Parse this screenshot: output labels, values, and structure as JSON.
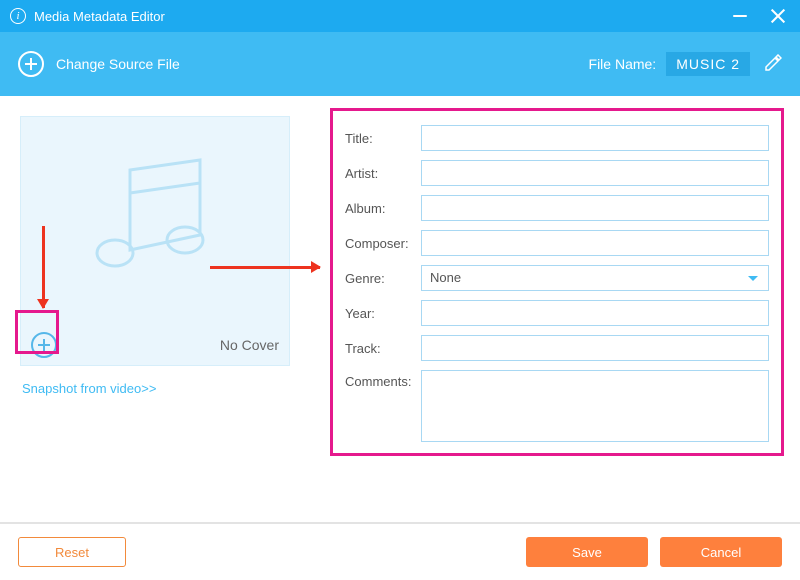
{
  "titlebar": {
    "title": "Media Metadata Editor"
  },
  "toolbar": {
    "change_source_label": "Change Source File",
    "file_name_label": "File Name:",
    "file_name_value": "MUSIC 2"
  },
  "cover": {
    "no_cover_label": "No Cover",
    "snapshot_link": "Snapshot from video>>"
  },
  "form": {
    "title": {
      "label": "Title:",
      "value": ""
    },
    "artist": {
      "label": "Artist:",
      "value": ""
    },
    "album": {
      "label": "Album:",
      "value": ""
    },
    "composer": {
      "label": "Composer:",
      "value": ""
    },
    "genre": {
      "label": "Genre:",
      "value": "None"
    },
    "year": {
      "label": "Year:",
      "value": ""
    },
    "track": {
      "label": "Track:",
      "value": ""
    },
    "comments": {
      "label": "Comments:",
      "value": ""
    }
  },
  "footer": {
    "reset_label": "Reset",
    "save_label": "Save",
    "cancel_label": "Cancel"
  },
  "colors": {
    "primary_blue": "#3FBBF3",
    "title_blue": "#1DAAF0",
    "orange": "#FE803D",
    "highlight_pink": "#E5198D",
    "arrow_red": "#ED331F"
  }
}
